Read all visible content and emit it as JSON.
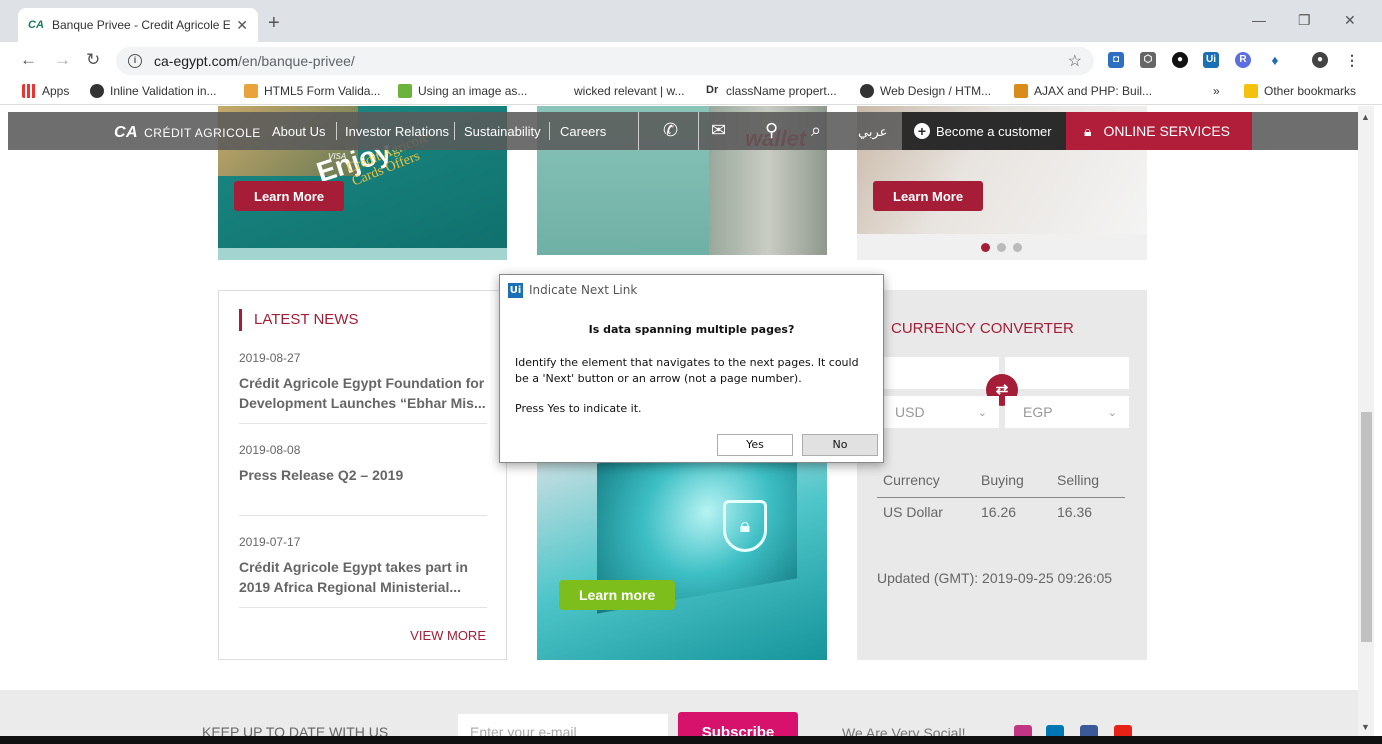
{
  "browser": {
    "tab_title": "Banque Privee - Credit Agricole E",
    "url_host": "ca-egypt.com",
    "url_path": "/en/banque-privee/",
    "bookmarks": [
      "Apps",
      "Inline Validation in...",
      "HTML5 Form Valida...",
      "Using an image as...",
      "wicked relevant | w...",
      "className propert...",
      "Web Design / HTM...",
      "AJAX and PHP: Buil..."
    ],
    "bookmarks_overflow": "»",
    "other_bookmarks": "Other bookmarks"
  },
  "header": {
    "logo_text": "CRÉDIT AGRICOLE",
    "nav": [
      "About Us",
      "Investor Relations",
      "Sustainability",
      "Careers"
    ],
    "arabic": "عربي",
    "become_customer": "Become a customer",
    "online_services": "ONLINE SERVICES"
  },
  "banners": {
    "learn_more_1": "Learn More",
    "learn_more_2": "Learn More",
    "learn_more_3": "Learn more",
    "enjoy_text": "Enjoy",
    "cards_offers_text": "Crédit Agricole Cards Offers",
    "visa": "VISA",
    "wallet": "wallet"
  },
  "news": {
    "heading": "LATEST NEWS",
    "items": [
      {
        "date": "2019-08-27",
        "title": "Crédit Agricole Egypt Foundation for Development Launches “Ebhar Mis..."
      },
      {
        "date": "2019-08-08",
        "title": "Press Release Q2 – 2019"
      },
      {
        "date": "2019-07-17",
        "title": "Crédit Agricole Egypt takes part in 2019 Africa Regional Ministerial..."
      }
    ],
    "view_more": "VIEW MORE"
  },
  "converter": {
    "heading": "CURRENCY CONVERTER",
    "from_currency": "USD",
    "to_currency": "EGP",
    "columns": [
      "Currency",
      "Buying",
      "Selling"
    ],
    "rows": [
      {
        "currency": "US Dollar",
        "buying": "16.26",
        "selling": "16.36"
      }
    ],
    "updated": "Updated (GMT): 2019-09-25 09:26:05"
  },
  "footer": {
    "keep_up": "KEEP UP TO DATE WITH US",
    "email_placeholder": "Enter your e-mail",
    "subscribe": "Subscribe",
    "social": "We Are Very Social!"
  },
  "dialog": {
    "title": "Indicate Next Link",
    "question": "Is data spanning multiple pages?",
    "body": "Identify the element that navigates to the next pages. It could be a 'Next' button or an arrow (not a page number).",
    "instruction": "Press Yes to indicate it.",
    "yes": "Yes",
    "no": "No"
  },
  "colors": {
    "brand_red": "#a51d36",
    "subscribe_pink": "#d6126c",
    "learn_more_green": "#7dbd1c"
  }
}
